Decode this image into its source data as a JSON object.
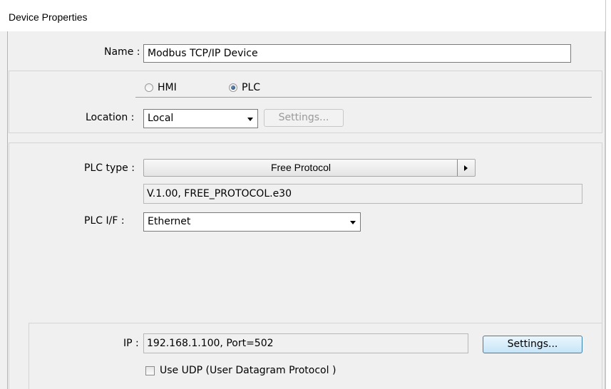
{
  "window": {
    "title": "Device Properties"
  },
  "name_field": {
    "label": "Name :",
    "value": "Modbus TCP/IP Device"
  },
  "device_kind": {
    "options": [
      {
        "label": "HMI",
        "checked": false
      },
      {
        "label": "PLC",
        "checked": true
      }
    ]
  },
  "location": {
    "label": "Location :",
    "selected": "Local",
    "settings_label": "Settings..."
  },
  "plc_type": {
    "label": "PLC type :",
    "value": "Free Protocol",
    "version": "V.1.00, FREE_PROTOCOL.e30"
  },
  "plc_if": {
    "label": "PLC I/F :",
    "selected": "Ethernet"
  },
  "ip": {
    "label": "IP :",
    "value": "192.168.1.100,  Port=502",
    "settings_label": "Settings..."
  },
  "udp": {
    "label": "Use UDP (User Datagram Protocol )",
    "checked": false
  }
}
